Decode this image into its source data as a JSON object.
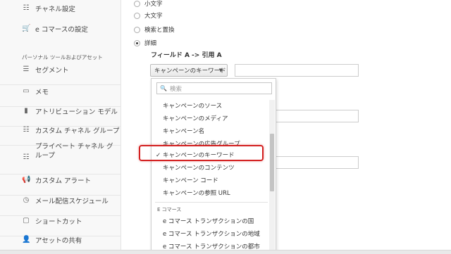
{
  "sidebar": {
    "top_items": [
      {
        "label": "チャネル設定",
        "icon": "channel-settings-icon"
      },
      {
        "label": "e コマースの設定",
        "icon": "cart-icon"
      }
    ],
    "section_title": "パーソナル ツールおよびアセット",
    "items": [
      {
        "label": "セグメント",
        "icon": "segment-icon"
      },
      {
        "label": "メモ",
        "icon": "memo-icon"
      },
      {
        "label": "アトリビューション モデル",
        "icon": "bar-chart-icon"
      },
      {
        "label": "カスタム チャネル グループ",
        "icon": "channel-group-icon"
      },
      {
        "label": "プライベート チャネル グループ",
        "icon": "private-channel-icon"
      },
      {
        "label": "カスタム アラート",
        "icon": "megaphone-icon"
      },
      {
        "label": "メール配信スケジュール",
        "icon": "clock-icon"
      },
      {
        "label": "ショートカット",
        "icon": "shortcut-icon"
      },
      {
        "label": "アセットの共有",
        "icon": "share-user-icon"
      }
    ]
  },
  "options": {
    "radios": [
      {
        "label": "小文字",
        "checked": false
      },
      {
        "label": "大文字",
        "checked": false
      },
      {
        "label": "検索と置換",
        "checked": false
      },
      {
        "label": "詳細",
        "checked": true
      }
    ],
    "field_label": "フィールド A -> 引用 A",
    "select_value": "キャンペーンのキーワード"
  },
  "dropdown": {
    "search_placeholder": "検索",
    "items": [
      "キャンペーンのソース",
      "キャンペーンのメディア",
      "キャンペーン名",
      "キャンペーンの広告グループ",
      "キャンペーンのキーワード",
      "キャンペーンのコンテンツ",
      "キャンペーン コード",
      "キャンペーンの参照 URL"
    ],
    "selected_index": 4,
    "category": "E コマース",
    "ecommerce_items": [
      "e コマース トランザクションの国",
      "e コマース トランザクションの地域",
      "e コマース トランザクションの都市"
    ]
  },
  "colors": {
    "highlight": "#d32020"
  }
}
